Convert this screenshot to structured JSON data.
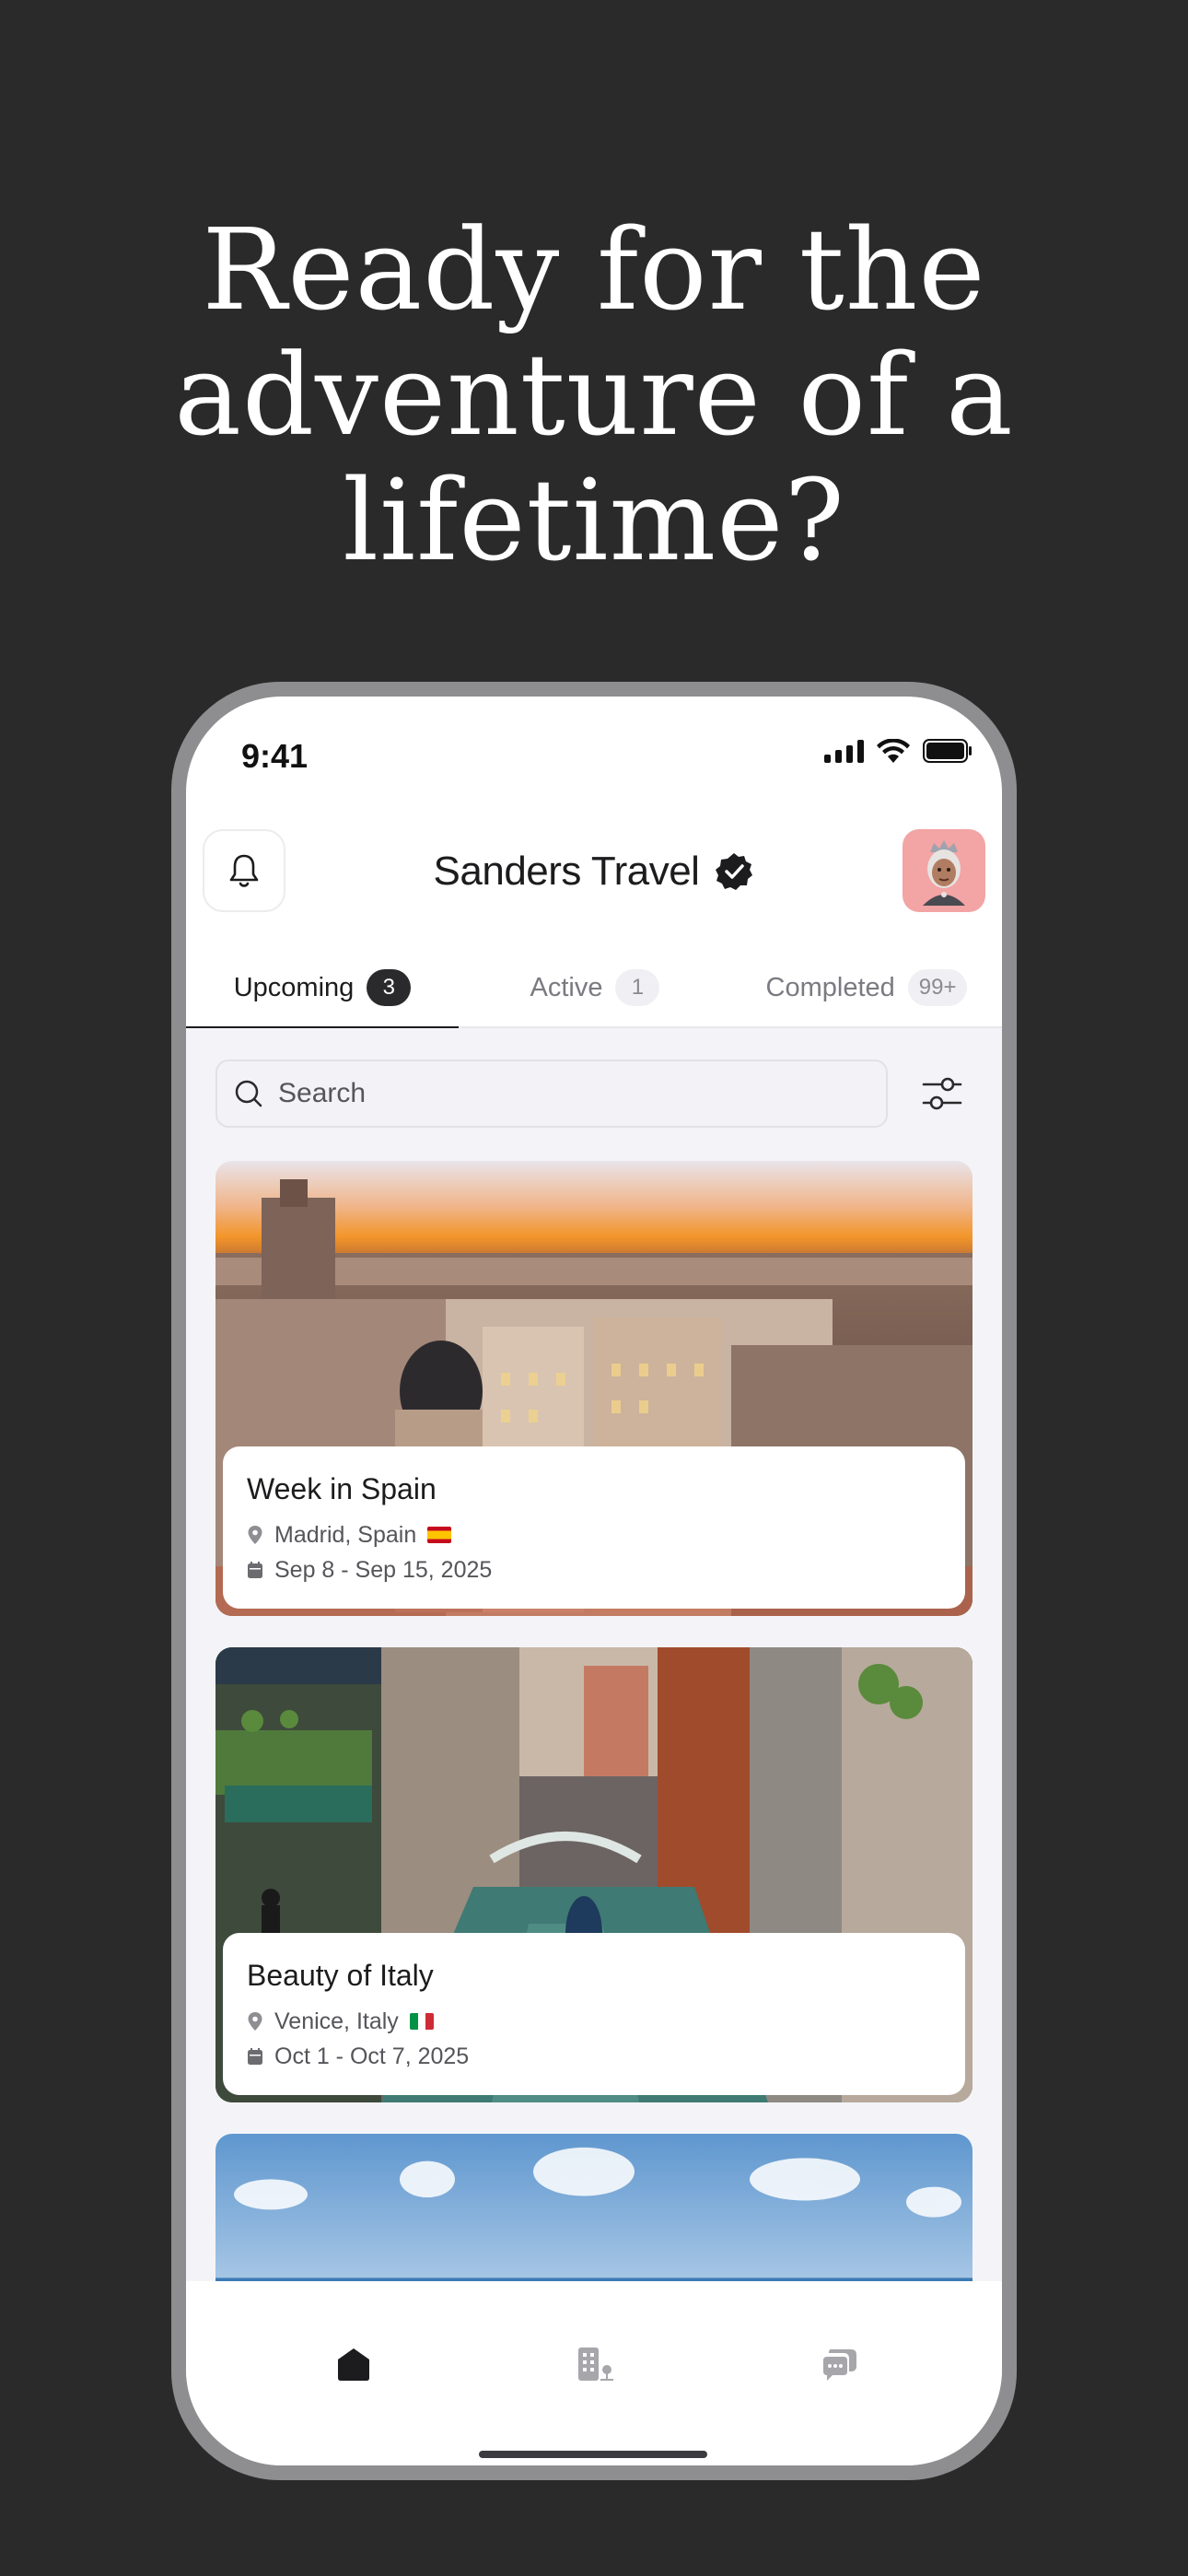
{
  "headline": {
    "line1": "Ready for the",
    "line2": "adventure of a",
    "line3": "lifetime?"
  },
  "status_bar": {
    "time": "9:41"
  },
  "header": {
    "title": "Sanders Travel",
    "bell_icon": "bell-icon",
    "verified_icon": "verified-badge-icon",
    "avatar": "user-avatar"
  },
  "tabs": [
    {
      "label": "Upcoming",
      "badge": "3",
      "active": true
    },
    {
      "label": "Active",
      "badge": "1",
      "active": false
    },
    {
      "label": "Completed",
      "badge": "99+",
      "active": false
    }
  ],
  "search": {
    "placeholder": "Search",
    "icon": "search-icon",
    "filter_icon": "filter-sliders-icon"
  },
  "trips": [
    {
      "title": "Week in Spain",
      "location": "Madrid, Spain",
      "dates": "Sep 8 - Sep 15, 2025",
      "flag": "spain-flag"
    },
    {
      "title": "Beauty of Italy",
      "location": "Venice, Italy",
      "dates": "Oct 1 - Oct 7, 2025",
      "flag": "italy-flag"
    }
  ],
  "bottom_nav": [
    {
      "icon": "home-icon",
      "active": true
    },
    {
      "icon": "hotel-icon",
      "active": false
    },
    {
      "icon": "chat-icon",
      "active": false
    }
  ],
  "colors": {
    "background": "#2b2a2b",
    "phone_frame": "#8e8e90",
    "accent_dark": "#1c1c1e",
    "avatar_bg": "#f3a4a4",
    "content_bg": "#f4f4f8"
  }
}
